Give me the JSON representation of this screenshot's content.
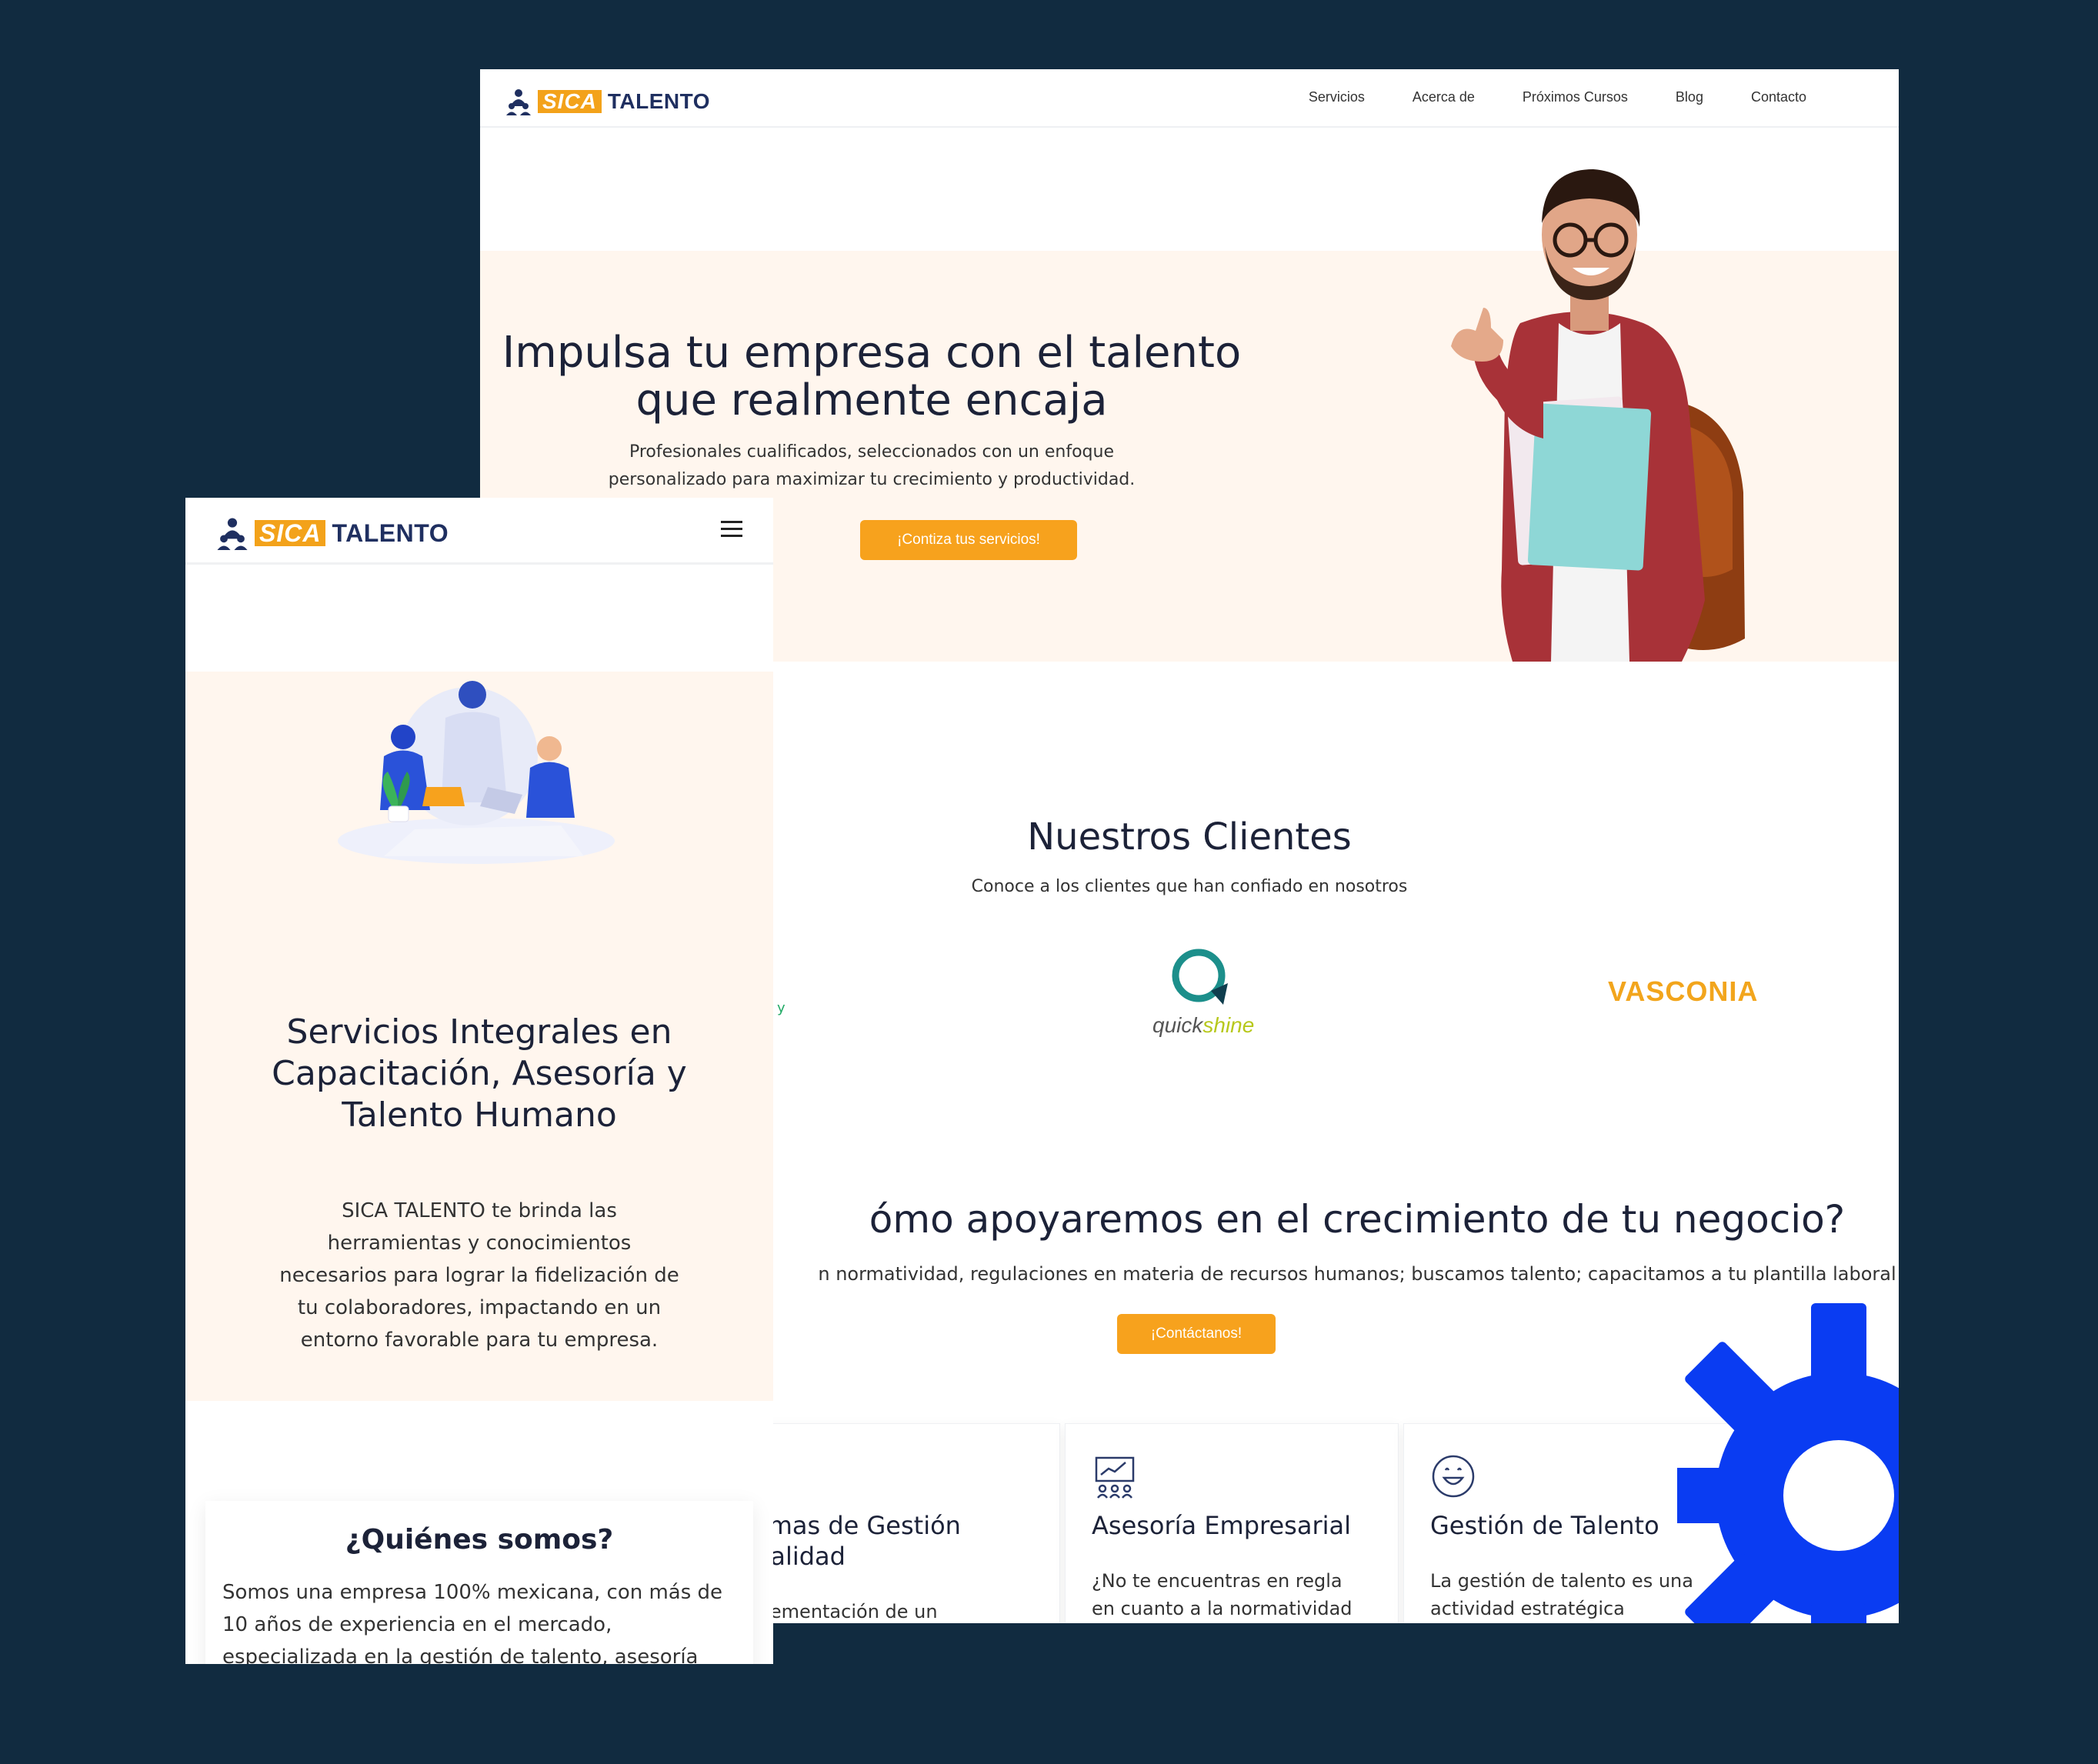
{
  "brand": {
    "sica": "SICA",
    "talento": "TALENTO"
  },
  "desktop": {
    "nav": [
      "Servicios",
      "Acerca de",
      "Próximos Cursos",
      "Blog",
      "Contacto"
    ],
    "hero": {
      "title": "Impulsa tu empresa con el talento que realmente encaja",
      "subtitle": "Profesionales cualificados, seleccionados con un enfoque personalizado para maximizar tu crecimiento y productividad.",
      "cta": "¡Contiza tus servicios!"
    },
    "clients": {
      "title": "Nuestros Clientes",
      "subtitle": "Conoce a los clientes que han confiado en nosotros",
      "logos": [
        "quickshine",
        "VASCONIA"
      ],
      "partial_logo_text": "y"
    },
    "how": {
      "title": "ómo apoyaremos en el crecimiento de tu negocio?",
      "subtitle": "n normatividad, regulaciones en materia de recursos humanos; buscamos talento; capacitamos a tu plantilla laboral",
      "cta": "¡Contáctanos!"
    },
    "cards": [
      {
        "title": "emas de Gestión\nCalidad",
        "text": "plementación de un",
        "icon": "quality-icon"
      },
      {
        "title": "Asesoría Empresarial",
        "text": "¿No te encuentras en regla en cuanto a la normatividad",
        "icon": "presentation-icon"
      },
      {
        "title": "Gestión de Talento",
        "text": "La gestión de talento es una actividad estratégica",
        "icon": "smile-icon"
      }
    ]
  },
  "mobile": {
    "hero": {
      "title": "Servicios Integrales en Capacitación, Asesoría y Talento Humano",
      "text": "SICA TALENTO te brinda las herramientas y conocimientos necesarios para lograr la fidelización de tu colaboradores, impactando en un entorno favorable para tu empresa."
    },
    "about": {
      "title": "¿Quiénes somos?",
      "text": "Somos una empresa 100% mexicana, con más de 10 años de experiencia en el mercado, especializada en la gestión de talento, asesoría empresarial y sistemas de"
    }
  },
  "colors": {
    "background": "#112b40",
    "accent": "#f7a21d",
    "hero_bg": "#fff6ee",
    "gear": "#0a3cf2",
    "navy": "#1f2f60"
  }
}
